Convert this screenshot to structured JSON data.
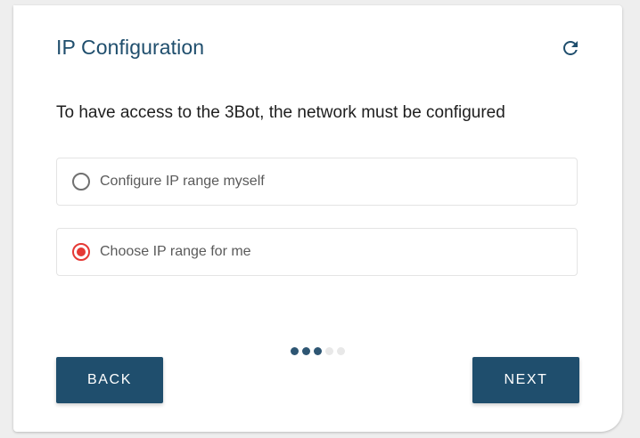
{
  "card": {
    "title": "IP Configuration",
    "refresh_icon": "refresh-icon",
    "subtitle": "To have access to the 3Bot, the network must be configured"
  },
  "options": [
    {
      "label": "Configure IP range myself",
      "selected": false
    },
    {
      "label": "Choose IP range for me",
      "selected": true
    }
  ],
  "stepper": {
    "total_steps": 5,
    "completed_steps": 3
  },
  "buttons": {
    "back_label": "BACK",
    "next_label": "NEXT"
  },
  "colors": {
    "primary": "#1f4e6d",
    "radio_selected": "#e53935",
    "radio_unselected": "#707070"
  }
}
